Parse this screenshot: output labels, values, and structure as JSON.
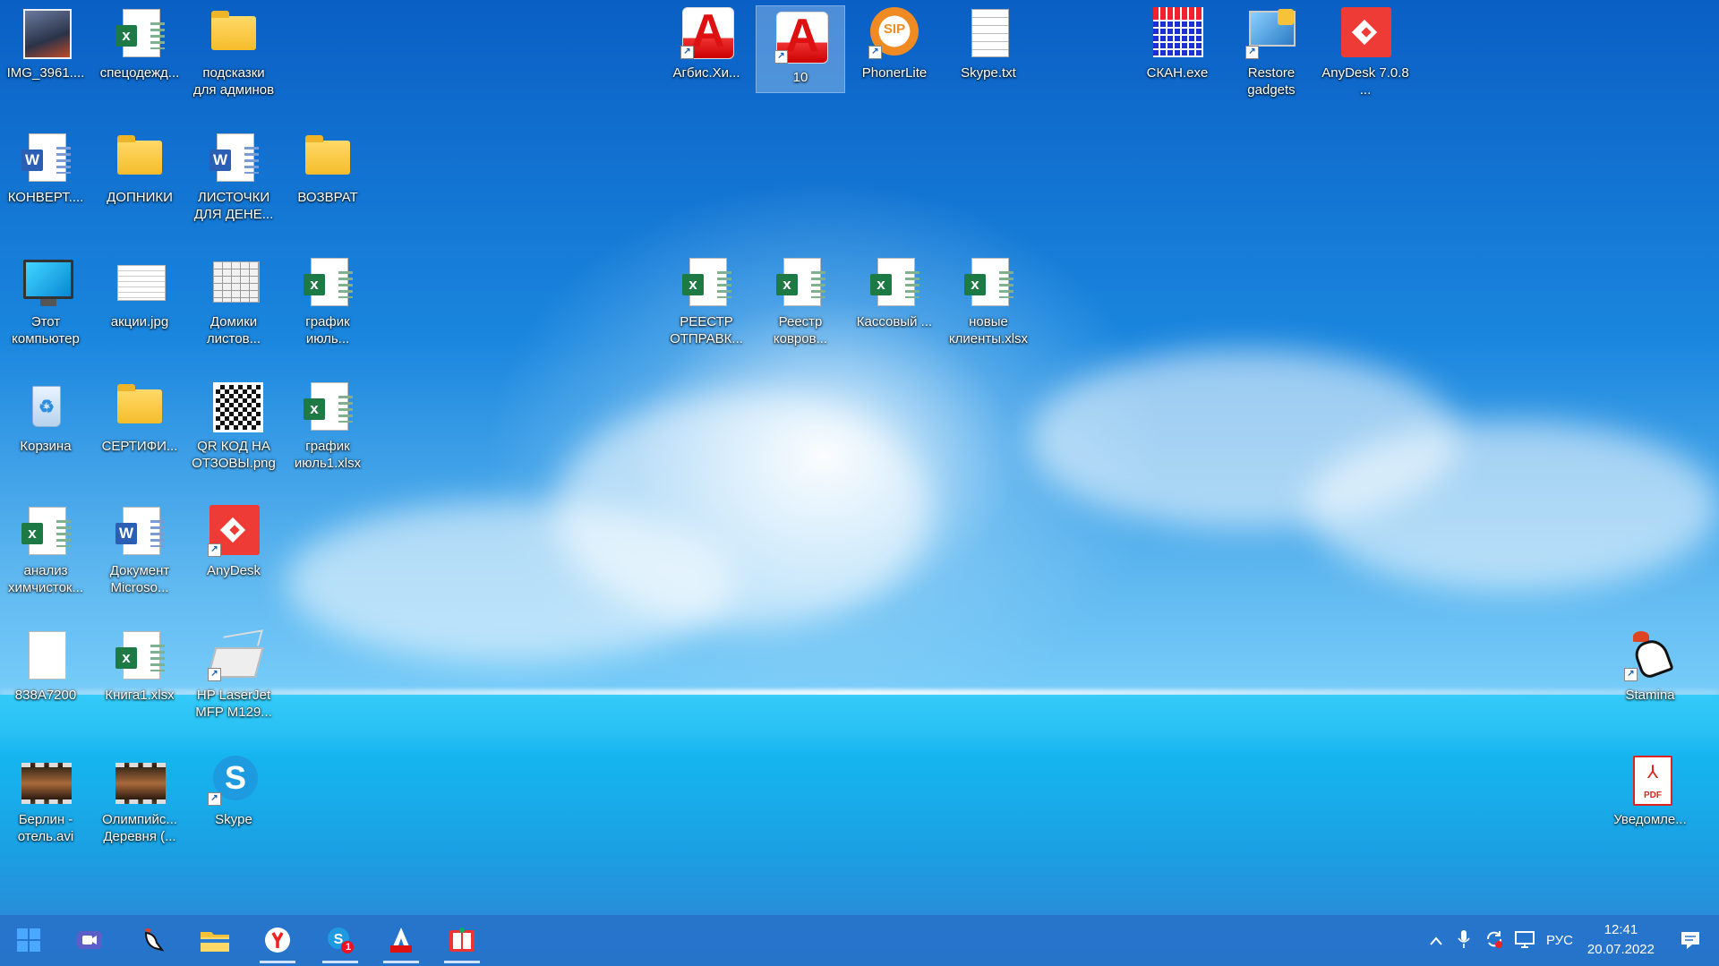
{
  "desktop": {
    "icons": [
      {
        "name": "img-3961",
        "label": "IMG_3961...."
      },
      {
        "name": "specodezhda",
        "label": "спецодежд..."
      },
      {
        "name": "podskazki",
        "label": "подсказки для админов"
      },
      {
        "name": "konvert",
        "label": "КОНВЕРТ...."
      },
      {
        "name": "dopniki",
        "label": "ДОПНИКИ"
      },
      {
        "name": "listochki",
        "label": "ЛИСТОЧКИ ДЛЯ ДЕНЕ..."
      },
      {
        "name": "vozvrat",
        "label": "ВОЗВРАТ"
      },
      {
        "name": "this-pc",
        "label": "Этот компьютер"
      },
      {
        "name": "akcii",
        "label": "акции.jpg"
      },
      {
        "name": "domiki",
        "label": "Домики листов..."
      },
      {
        "name": "grafik-iyul",
        "label": "график июль..."
      },
      {
        "name": "recycle-bin",
        "label": "Корзина"
      },
      {
        "name": "sertifi",
        "label": "СЕРТИФИ..."
      },
      {
        "name": "qr-kod",
        "label": "QR КОД НА ОТЗОВЫ.png"
      },
      {
        "name": "grafik-iyul1",
        "label": "график июль1.xlsx"
      },
      {
        "name": "analiz",
        "label": "анализ химчисток..."
      },
      {
        "name": "dokument",
        "label": "Документ Microso..."
      },
      {
        "name": "anydesk",
        "label": "AnyDesk"
      },
      {
        "name": "838a7200",
        "label": "838A7200"
      },
      {
        "name": "kniga1",
        "label": "Книга1.xlsx"
      },
      {
        "name": "hp-laserjet",
        "label": "HP LaserJet MFP M129..."
      },
      {
        "name": "berlin",
        "label": "Берлин - отель.avi"
      },
      {
        "name": "olimpiyskaya",
        "label": "Олимпийс... Деревня (..."
      },
      {
        "name": "skype",
        "label": "Skype"
      },
      {
        "name": "argus",
        "label": "Агбис.Хи..."
      },
      {
        "name": "ten",
        "label": "10"
      },
      {
        "name": "phonerlite",
        "label": "PhonerLite"
      },
      {
        "name": "skype-txt",
        "label": "Skype.txt"
      },
      {
        "name": "skan",
        "label": "СКАН.exe"
      },
      {
        "name": "restore-gadgets",
        "label": "Restore gadgets"
      },
      {
        "name": "anydesk-708",
        "label": "AnyDesk 7.0.8 ..."
      },
      {
        "name": "reestr-otpravk",
        "label": "РЕЕСТР ОТПРАВК..."
      },
      {
        "name": "reestr-kovrov",
        "label": "Реестр ковров..."
      },
      {
        "name": "kassovy",
        "label": "Кассовый ..."
      },
      {
        "name": "novye-klienty",
        "label": "новые клиенты.xlsx"
      },
      {
        "name": "stamina",
        "label": "Stamina"
      },
      {
        "name": "uvedomle",
        "label": "Уведомле..."
      }
    ]
  },
  "taskbar": {
    "tray": {
      "language": "РУС",
      "time": "12:41",
      "date": "20.07.2022",
      "skype_badge": "1"
    }
  }
}
